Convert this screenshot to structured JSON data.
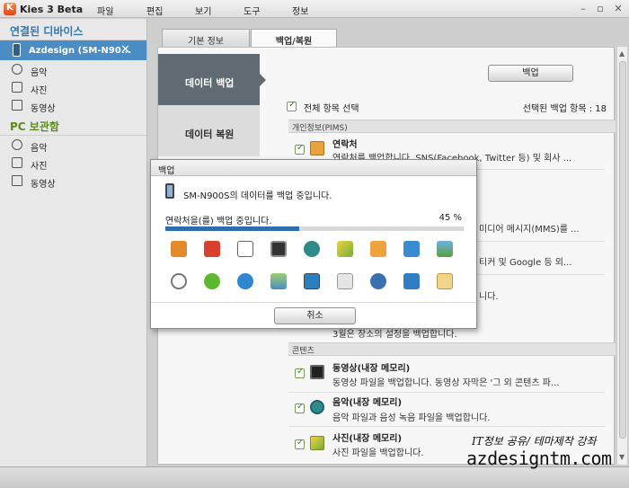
{
  "app": {
    "title": "Kies 3 Beta"
  },
  "menu": [
    "파일",
    "편집",
    "보기",
    "도구",
    "정보"
  ],
  "sidebar": {
    "connected_header": "연결된 디바이스",
    "device_name": "Azdesign (SM-N90...",
    "device_items": [
      "음악",
      "사진",
      "동영상"
    ],
    "pc_header": "PC 보관함",
    "pc_items": [
      "음악",
      "사진",
      "동영상"
    ]
  },
  "tabs": [
    "기본 정보",
    "백업/복원"
  ],
  "side_tabs": [
    "데이터 백업",
    "데이터 복원"
  ],
  "backup": {
    "button": "백업",
    "select_all": "전체 항목 선택",
    "selected_count": "선택된 백업 항목 : 18",
    "group_pims": "개인정보(PIMS)",
    "group_contents": "콘텐츠",
    "items": [
      {
        "title": "연락처",
        "desc": "연락처를 백업합니다. SNS(Facebook, Twitter 등) 및 회사 ..."
      },
      {
        "title": "",
        "desc": "미디어 메시지(MMS)를 ..."
      },
      {
        "title": "",
        "desc": "티커 및 Google 등 외..."
      },
      {
        "title": "",
        "desc": "니다."
      },
      {
        "title": "",
        "desc": "3월은 장소의 설정을 백업합니다."
      },
      {
        "title": "동영상(내장 메모리)",
        "desc": "동영상 파일을 백업합니다. 동영상 자막은 '그 외 콘텐츠 파..."
      },
      {
        "title": "음악(내장 메모리)",
        "desc": "음악 파일과 음성 녹음 파일을 백업합니다."
      },
      {
        "title": "사진(내장 메모리)",
        "desc": "사진 파일을 백업합니다."
      }
    ]
  },
  "dialog": {
    "title": "백업",
    "message": "SM-N900S의 데이터를 백업 중입니다.",
    "progress_label": "연락처을(를) 백업 중입니다.",
    "progress_text": "45 %",
    "progress": 0.45,
    "cancel": "취소",
    "icons": [
      "contacts-icon",
      "s-planner-icon",
      "calendar-icon",
      "video-icon",
      "music-icon",
      "gallery-icon",
      "folder-icon",
      "call-log-icon",
      "picture-icon",
      "clock-icon",
      "s-health-icon",
      "wifi-icon",
      "photo-settings-icon",
      "phone-icon",
      "mms-icon",
      "settings-icon",
      "apps-icon",
      "email-icon"
    ]
  },
  "watermark": {
    "line1": "IT정보 공유/ 테마제작 강좌",
    "line2": "azdesigntm.com"
  },
  "colors": {
    "accent": "#2e6eaa",
    "sidebar_selected": "#4a8cc4",
    "pc_header": "#5a8c1d",
    "active_tab": "#606a72"
  }
}
